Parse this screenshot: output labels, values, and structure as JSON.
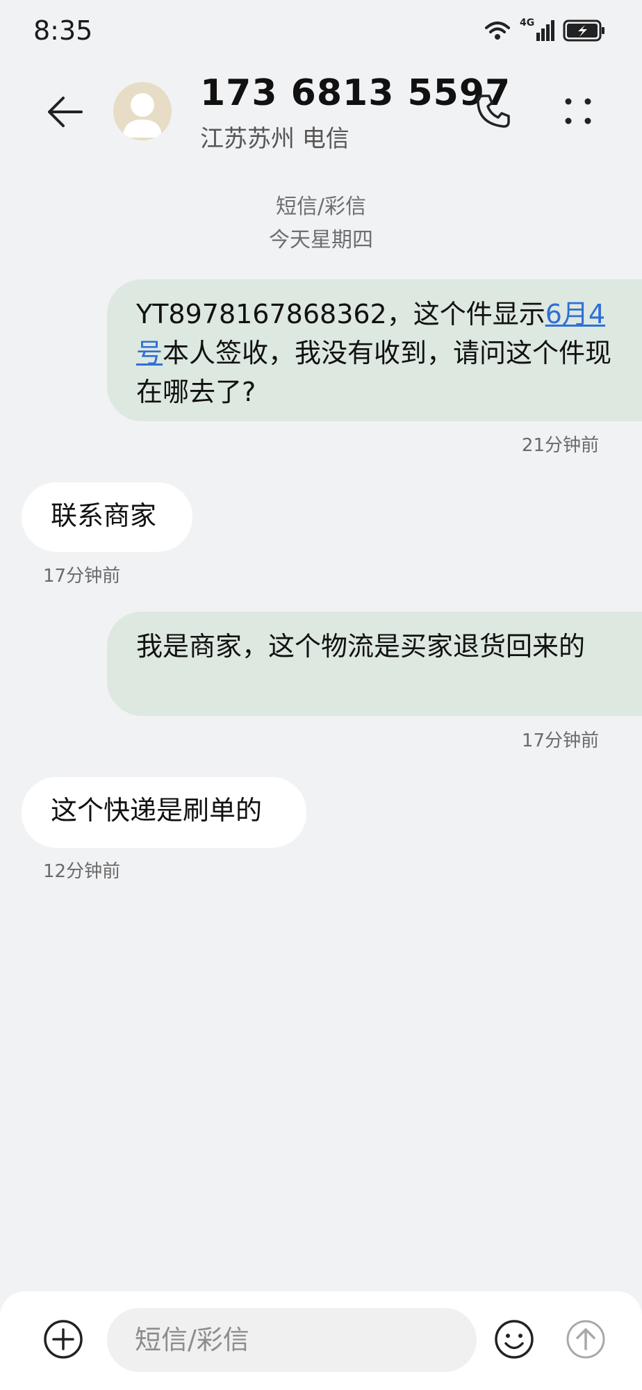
{
  "status_bar": {
    "time": "8:35",
    "network": "4G",
    "icons": [
      "wifi-icon",
      "signal-icon",
      "battery-charging-icon"
    ]
  },
  "header": {
    "contact_number": "173 6813 5597",
    "location": "江苏苏州 电信",
    "icons": [
      "back-arrow-icon",
      "avatar-person-icon",
      "phone-icon",
      "more-icon"
    ]
  },
  "conversation": {
    "type_label": "短信/彩信",
    "date_label": "今天星期四",
    "messages": [
      {
        "direction": "outgoing",
        "text_before": "YT8978167868362，这个件显示",
        "text_link": "6月4号",
        "text_after": "本人签收，我没有收到，请问这个件现在哪去了?",
        "time": "21分钟前"
      },
      {
        "direction": "incoming",
        "text": "联系商家",
        "time": "17分钟前"
      },
      {
        "direction": "outgoing",
        "text": "我是商家，这个物流是买家退货回来的",
        "time": "17分钟前"
      },
      {
        "direction": "incoming",
        "text": "这个快递是刷单的",
        "time": "12分钟前"
      }
    ]
  },
  "input_bar": {
    "placeholder": "短信/彩信",
    "icons": [
      "add-icon",
      "emoji-icon",
      "send-icon"
    ]
  },
  "colors": {
    "background": "#f1f2f4",
    "outgoing_bubble": "#dde8e0",
    "incoming_bubble": "#ffffff",
    "link": "#2f6fd6"
  }
}
